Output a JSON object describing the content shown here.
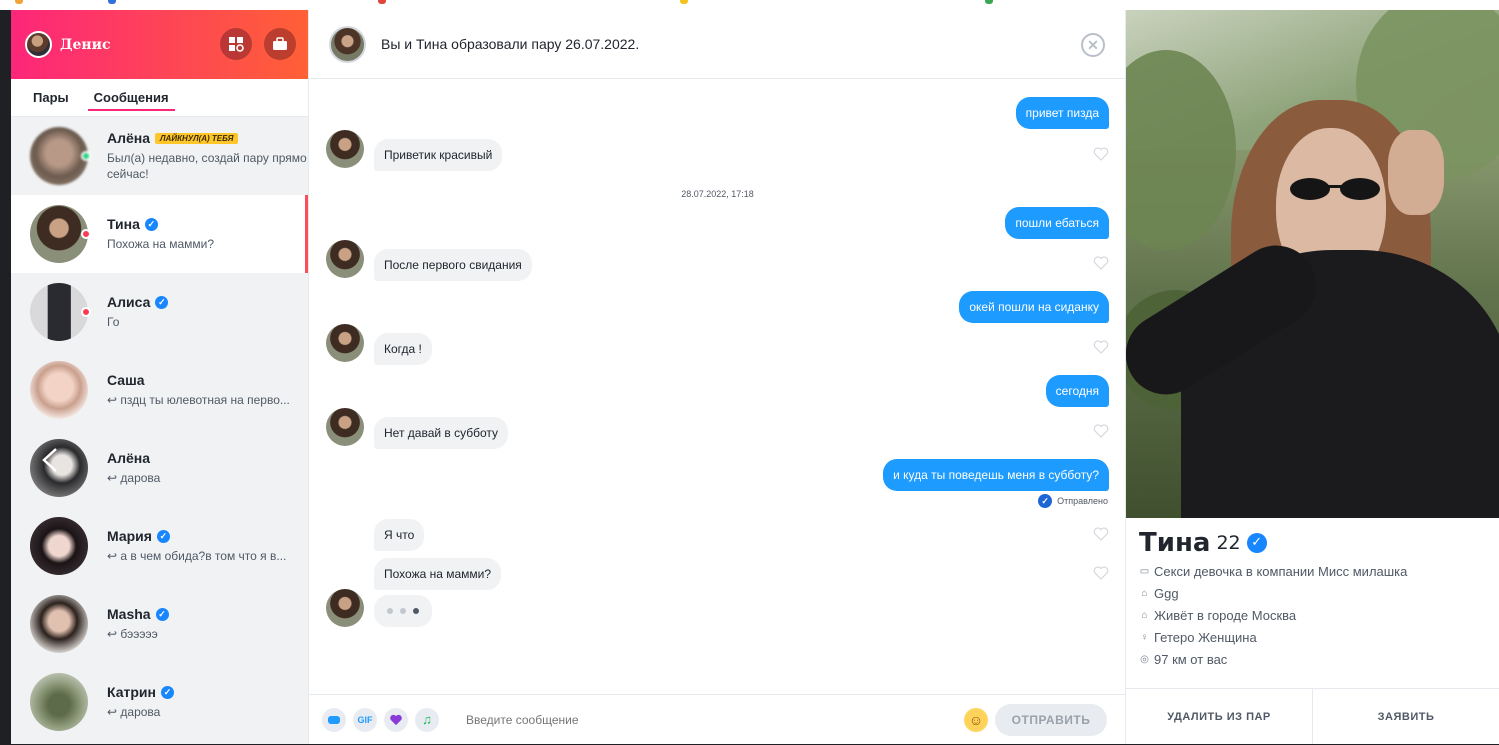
{
  "sidebar": {
    "user_name": "Денис",
    "tabs": [
      "Пары",
      "Сообщения"
    ],
    "conversations": [
      {
        "name": "Алёна",
        "badge": "ЛАЙКНУЛ(А) ТЕБЯ",
        "message": "Был(а) недавно, создай пару прямо сейчас!",
        "status": "online",
        "verified": false
      },
      {
        "name": "Тина",
        "message": "Похожа на мамми?",
        "status": "unread",
        "verified": true
      },
      {
        "name": "Алиса",
        "message": "Го",
        "status": "unread",
        "verified": true
      },
      {
        "name": "Саша",
        "message": "↩ пздц ты юлевотная на перво...",
        "verified": false
      },
      {
        "name": "Алёна",
        "message": "↩ дарова",
        "verified": false
      },
      {
        "name": "Мария",
        "message": "↩ а в чем обида?в том что я в...",
        "verified": true
      },
      {
        "name": "Masha",
        "message": "↩ бэээээ",
        "verified": true
      },
      {
        "name": "Катрин",
        "message": "↩ дарова",
        "verified": true
      }
    ]
  },
  "chat": {
    "header_title": "Вы и Тина образовали пару 26.07.2022.",
    "timestamp": "28.07.2022, 17:18",
    "sent_status": "Отправлено",
    "messages": [
      {
        "dir": "out",
        "text": "привет пизда"
      },
      {
        "dir": "in",
        "text": "Приветик красивый"
      },
      {
        "dir": "out",
        "text": "пошли ебаться"
      },
      {
        "dir": "in",
        "text": "После первого свидания"
      },
      {
        "dir": "out",
        "text": "окей пошли на сиданку"
      },
      {
        "dir": "in",
        "text": "Когда !"
      },
      {
        "dir": "out",
        "text": "сегодня"
      },
      {
        "dir": "in",
        "text": "Нет давай в субботу"
      },
      {
        "dir": "out",
        "text": "и куда ты поведешь меня в субботу?"
      },
      {
        "dir": "in",
        "text": "Я что"
      },
      {
        "dir": "in",
        "text": "Похожа на мамми?"
      }
    ],
    "composer": {
      "placeholder": "Введите сообщение",
      "gif_label": "GIF",
      "send_label": "ОТПРАВИТЬ"
    }
  },
  "profile": {
    "name": "Тина",
    "age": "22",
    "details": [
      {
        "icon": "job-icon",
        "text": "Секси девочка в компании Мисс милашка"
      },
      {
        "icon": "school-icon",
        "text": "Ggg"
      },
      {
        "icon": "home-icon",
        "text": "Живёт в городе Москва"
      },
      {
        "icon": "gender-icon",
        "text": "Гетеро Женщина"
      },
      {
        "icon": "location-icon",
        "text": "97 км от вас"
      }
    ],
    "actions": {
      "unmatch": "УДАЛИТЬ ИЗ ПАР",
      "report": "ЗАЯВИТЬ"
    }
  },
  "colors": {
    "brand_start": "#fd267a",
    "brand_end": "#ff6036",
    "bubble_out": "#1e9bff",
    "bubble_in": "#f0f2f4",
    "verified": "#1786ff"
  }
}
